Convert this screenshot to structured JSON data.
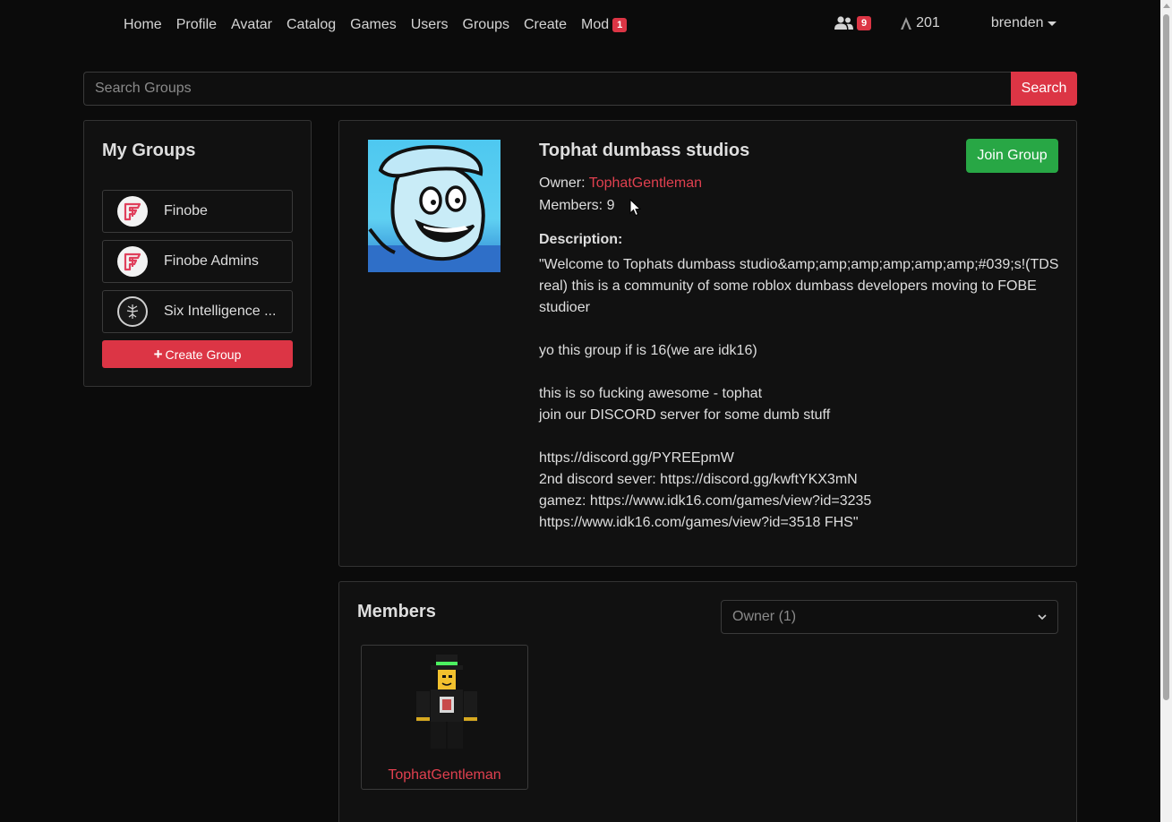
{
  "nav": {
    "links": [
      {
        "label": "Home"
      },
      {
        "label": "Profile"
      },
      {
        "label": "Avatar"
      },
      {
        "label": "Catalog"
      },
      {
        "label": "Games"
      },
      {
        "label": "Users"
      },
      {
        "label": "Groups"
      },
      {
        "label": "Create"
      },
      {
        "label": "Mod",
        "badge": "1"
      }
    ],
    "friends_icon": "users-icon",
    "friend_requests": "9",
    "currency_icon": "currency-icon",
    "currency": "201",
    "username": "brenden"
  },
  "search": {
    "placeholder": "Search Groups",
    "button": "Search"
  },
  "my_groups": {
    "title": "My Groups",
    "items": [
      {
        "name": "Finobe",
        "icon": "finobe-logo-icon"
      },
      {
        "name": "Finobe Admins",
        "icon": "finobe-logo-icon"
      },
      {
        "name": "Six Intelligence ...",
        "icon": "emblem-icon"
      }
    ],
    "create_label": "Create Group"
  },
  "group": {
    "title": "Tophat dumbass studios",
    "join_label": "Join Group",
    "owner_label": "Owner:",
    "owner": "TophatGentleman",
    "members_line": "Members: 9",
    "description_label": "Description:",
    "description": "\"Welcome to Tophats dumbass studio&amp;amp;amp;amp;amp;amp;#039;s!(TDS real) this is a community of some roblox dumbass developers moving to FOBE studioer\n\nyo this group if is 16(we are idk16)\n\nthis is so fucking awesome - tophat\njoin our DISCORD server for some dumb stuff\n\nhttps://discord.gg/PYREEpmW\n2nd discord sever: https://discord.gg/kwftYKX3mN\ngamez: https://www.idk16.com/games/view?id=3235\nhttps://www.idk16.com/games/view?id=3518 FHS\""
  },
  "members": {
    "title": "Members",
    "role_filter": "Owner (1)",
    "list": [
      {
        "name": "TophatGentleman"
      }
    ]
  },
  "colors": {
    "accent_red": "#dc3545",
    "join_green": "#28a745",
    "link_red": "#e0404f",
    "background": "#0b0b0b"
  }
}
